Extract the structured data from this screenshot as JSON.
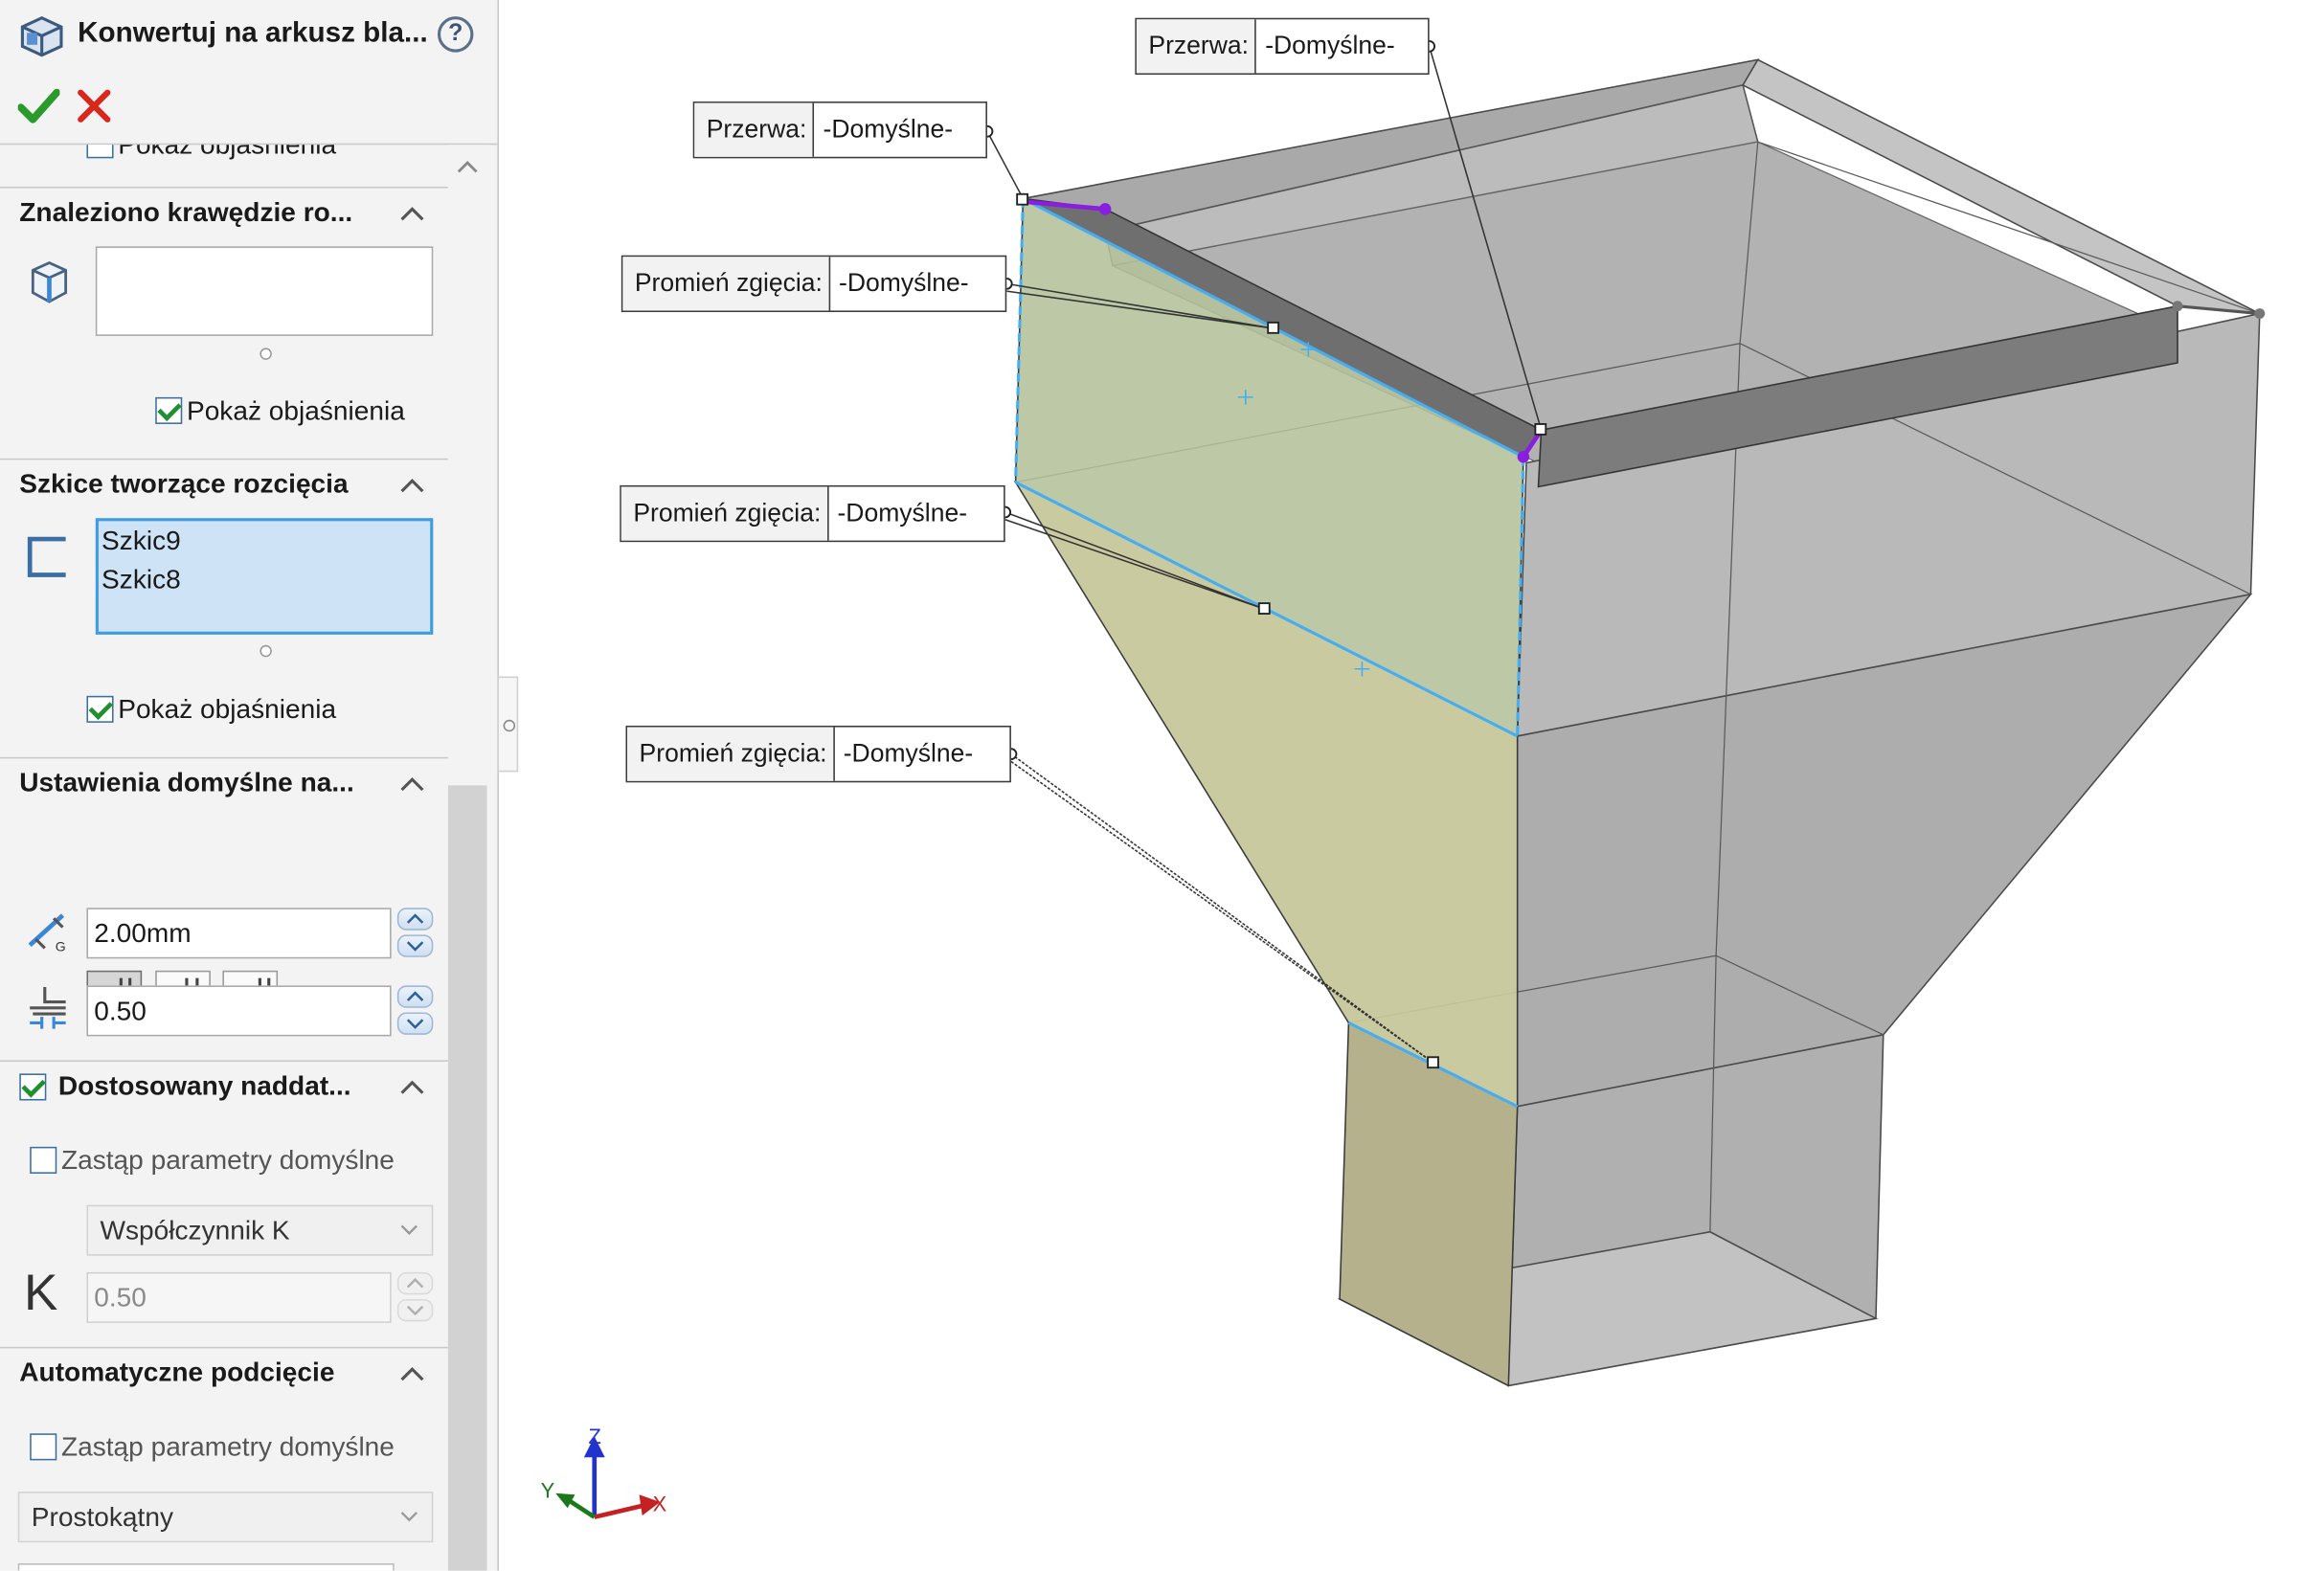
{
  "panel": {
    "title": "Konwertuj na arkusz bla...",
    "help_label": "?",
    "scrolled_partial_label": "Pokaż objaśnienia",
    "sections": {
      "edges": {
        "title": "Znaleziono krawędzie ro...",
        "show_callouts": "Pokaż objaśnienia"
      },
      "sketches": {
        "title": "Szkice tworzące rozcięcia",
        "items": [
          "Szkic9",
          "Szkic8"
        ],
        "show_callouts": "Pokaż objaśnienia"
      },
      "defaults": {
        "title": "Ustawienia domyślne na...",
        "gap_value": "2.00mm",
        "ratio_value": "0.50"
      },
      "allowance": {
        "title": "Dostosowany naddat...",
        "override_label": "Zastąp parametry domyślne",
        "type_selected": "Współczynnik K",
        "k_label": "K",
        "k_value": "0.50"
      },
      "relief": {
        "title": "Automatyczne podcięcie",
        "override_label": "Zastąp parametry domyślne",
        "type_selected": "Prostokątny"
      }
    }
  },
  "callouts": [
    {
      "label": "Przerwa:",
      "value": "-Domyślne-"
    },
    {
      "label": "Przerwa:",
      "value": "-Domyślne-"
    },
    {
      "label": "Promień zgięcia:",
      "value": "-Domyślne-"
    },
    {
      "label": "Promień zgięcia:",
      "value": "-Domyślne-"
    },
    {
      "label": "Promień zgięcia:",
      "value": "-Domyślne-"
    }
  ],
  "triad": {
    "x": "X",
    "y": "Y",
    "z": "Z"
  },
  "colors": {
    "selected_face": "#b3c09a",
    "body_gray": "#b4b4b4",
    "edge_highlight": "#46aef0",
    "rip_edge": "#8a1ee0"
  }
}
